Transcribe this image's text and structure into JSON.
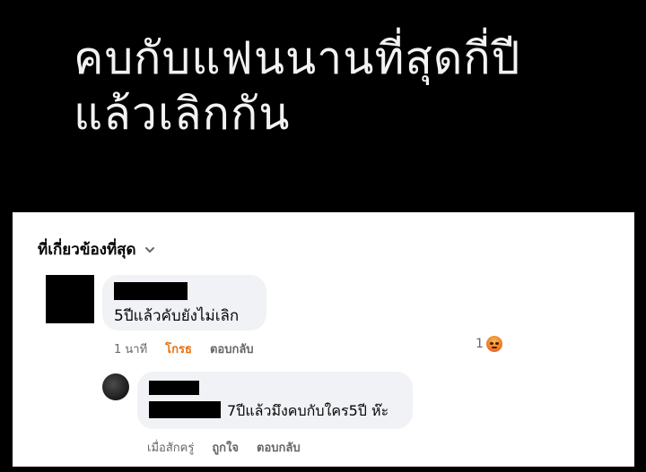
{
  "post": {
    "title_line1": "คบกับแฟนนานที่สุดกี่ปี",
    "title_line2": "แล้วเลิกกัน"
  },
  "comments_panel": {
    "sort_label": "ที่เกี่ยวข้องที่สุด",
    "sort_icon": "chevron-down-icon",
    "comments": [
      {
        "author_redacted": true,
        "text": "5ปีแล้วคับยังไม่เลิก",
        "time": "1 นาที",
        "reaction_label": "โกรธ",
        "reply_label": "ตอบกลับ",
        "reaction_count": "1",
        "reaction_icon": "angry-emoji-icon",
        "reaction_color": "#e9710f"
      },
      {
        "author_redacted": true,
        "mention_redacted": true,
        "text": "7ปีแล้วมึงคบกับใคร5ปี ห๊ะ",
        "time": "เมื่อสักครู่",
        "like_label": "ถูกใจ",
        "reply_label": "ตอบกลับ"
      }
    ]
  },
  "colors": {
    "background": "#000000",
    "panel": "#ffffff",
    "bubble": "#f0f2f5",
    "secondary_text": "#65676b"
  }
}
